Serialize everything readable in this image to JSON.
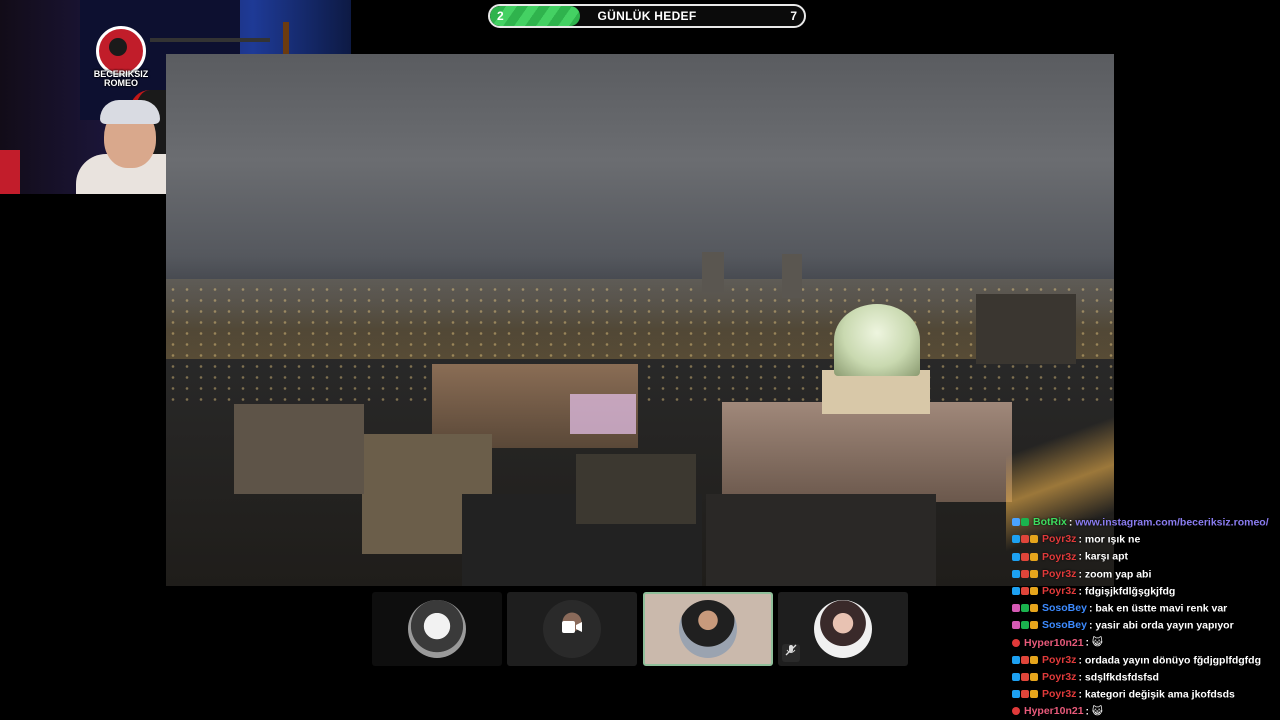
{
  "goal": {
    "current": "2",
    "title": "GÜNLÜK HEDEF",
    "target": "7",
    "progress_fraction": 0.286
  },
  "webcam": {
    "logo_text_line1": "BECERIKSIZ",
    "logo_text_line2": "ROMEO"
  },
  "participants": [
    {
      "id": "p1",
      "state": "avatar"
    },
    {
      "id": "p2",
      "state": "camera-off",
      "icon": "video-camera-icon"
    },
    {
      "id": "p3",
      "state": "active-speaker"
    },
    {
      "id": "p4",
      "state": "muted",
      "icon": "mic-muted-icon"
    }
  ],
  "chat": {
    "messages": [
      {
        "user": "BotRix",
        "color": "#3ddc5f",
        "text": "www.instagram.com/beceriksiz.romeo/",
        "text_color": "#8a7cf0",
        "badges": [
          "b-bot",
          "b-mod"
        ]
      },
      {
        "user": "Poyr3z",
        "color": "#e03a3a",
        "text": "mor ışık ne",
        "text_color": "#ffffff",
        "badges": [
          "b-prime",
          "b-sub",
          "b-vip"
        ]
      },
      {
        "user": "Poyr3z",
        "color": "#e03a3a",
        "text": "karşı apt",
        "text_color": "#ffffff",
        "badges": [
          "b-prime",
          "b-sub",
          "b-vip"
        ]
      },
      {
        "user": "Poyr3z",
        "color": "#e03a3a",
        "text": "zoom yap abi",
        "text_color": "#ffffff",
        "badges": [
          "b-prime",
          "b-sub",
          "b-vip"
        ]
      },
      {
        "user": "Poyr3z",
        "color": "#e03a3a",
        "text": "fdgişjkfdlğşgkjfdg",
        "text_color": "#ffffff",
        "badges": [
          "b-prime",
          "b-sub",
          "b-vip"
        ]
      },
      {
        "user": "SosoBey",
        "color": "#3d8bff",
        "text": "bak en üstte mavi renk var",
        "text_color": "#ffffff",
        "badges": [
          "b-pink",
          "b-mod",
          "b-vip"
        ]
      },
      {
        "user": "SosoBey",
        "color": "#3d8bff",
        "text": "yasir abi orda yayın yapıyor",
        "text_color": "#ffffff",
        "badges": [
          "b-pink",
          "b-mod",
          "b-vip"
        ]
      },
      {
        "user": "Hyper10n21",
        "color": "#e85a7a",
        "text": "😺",
        "text_color": "#ffffff",
        "badges": [
          "b-red"
        ]
      },
      {
        "user": "Poyr3z",
        "color": "#e03a3a",
        "text": "ordada yayın dönüyo fğdjgplfdgfdg",
        "text_color": "#ffffff",
        "badges": [
          "b-prime",
          "b-sub",
          "b-vip"
        ]
      },
      {
        "user": "Poyr3z",
        "color": "#e03a3a",
        "text": "sdşlfkdsfdsfsd",
        "text_color": "#ffffff",
        "badges": [
          "b-prime",
          "b-sub",
          "b-vip"
        ]
      },
      {
        "user": "Poyr3z",
        "color": "#e03a3a",
        "text": "kategori değişik ama jkofdsds",
        "text_color": "#ffffff",
        "badges": [
          "b-prime",
          "b-sub",
          "b-vip"
        ]
      },
      {
        "user": "Hyper10n21",
        "color": "#e85a7a",
        "text": "😺",
        "text_color": "#ffffff",
        "badges": [
          "b-red"
        ]
      }
    ]
  }
}
